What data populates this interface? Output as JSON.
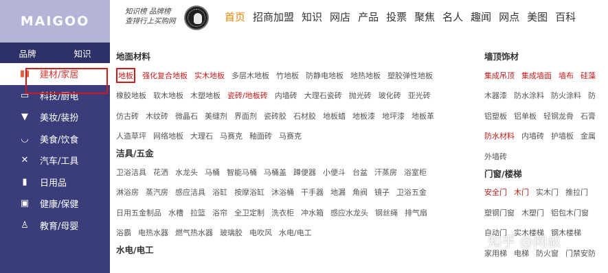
{
  "header": {
    "logo": "MAIGOO",
    "slogan_line1": "知识榜 品牌榜",
    "slogan_line2": "查排行上买购网",
    "nav": [
      "首页",
      "招商加盟",
      "知识",
      "网店",
      "产品",
      "投票",
      "聚焦",
      "名人",
      "趣闻",
      "网点",
      "美图",
      "百科"
    ]
  },
  "sidebar": {
    "tabs": [
      "品牌",
      "知识"
    ],
    "items": [
      {
        "icon": "building-icon",
        "label": "建材/家居"
      },
      {
        "icon": "monitor-icon",
        "label": "科技/厨电"
      },
      {
        "icon": "shirt-icon",
        "label": "美妆/装扮"
      },
      {
        "icon": "bowl-icon",
        "label": "美食/饮食"
      },
      {
        "icon": "tools-icon",
        "label": "汽车/工具"
      },
      {
        "icon": "bottle-icon",
        "label": "日用品"
      },
      {
        "icon": "medkit-icon",
        "label": "健康/保健"
      },
      {
        "icon": "child-icon",
        "label": "教育/母婴"
      }
    ]
  },
  "content": {
    "col1": [
      {
        "title": "地面材料",
        "rows": [
          [
            {
              "t": "地板",
              "boxed": true
            },
            {
              "t": "强化复合地板",
              "red": true
            },
            {
              "t": "实木地板",
              "red": true
            },
            {
              "t": "多层木地板"
            },
            {
              "t": "竹地板"
            },
            {
              "t": "防静电地板"
            },
            {
              "t": "地热地板"
            },
            {
              "t": "塑胶弹性地板"
            }
          ],
          [
            {
              "t": "橡胶地板"
            },
            {
              "t": "软木地板"
            },
            {
              "t": "木塑地板"
            },
            {
              "t": "瓷砖/地板砖",
              "red": true
            },
            {
              "t": "内墙砖"
            },
            {
              "t": "大理石瓷砖"
            },
            {
              "t": "抛光砖"
            },
            {
              "t": "玻化砖"
            },
            {
              "t": "亚光砖"
            }
          ],
          [
            {
              "t": "仿古砖"
            },
            {
              "t": "木纹砖"
            },
            {
              "t": "微晶石"
            },
            {
              "t": "美缝剂"
            },
            {
              "t": "界面剂"
            },
            {
              "t": "瓷砖胶"
            },
            {
              "t": "石材胶"
            },
            {
              "t": "地板蜡"
            },
            {
              "t": "地板漆"
            },
            {
              "t": "地坪漆"
            },
            {
              "t": "地板革"
            }
          ],
          [
            {
              "t": "人造草坪"
            },
            {
              "t": "网络地板"
            },
            {
              "t": "大理石"
            },
            {
              "t": "马赛克"
            },
            {
              "t": "釉面砖"
            },
            {
              "t": "马赛克"
            }
          ]
        ]
      },
      {
        "title": "洁具/五金",
        "rows": [
          [
            {
              "t": "卫浴洁具"
            },
            {
              "t": "花洒"
            },
            {
              "t": "水龙头"
            },
            {
              "t": "马桶"
            },
            {
              "t": "智能马桶"
            },
            {
              "t": "马桶盖"
            },
            {
              "t": "蹲便器"
            },
            {
              "t": "小便斗"
            },
            {
              "t": "台盆"
            },
            {
              "t": "汗蒸房"
            },
            {
              "t": "浴室柜"
            }
          ],
          [
            {
              "t": "淋浴房"
            },
            {
              "t": "蒸汽房"
            },
            {
              "t": "感应洁具"
            },
            {
              "t": "浴缸"
            },
            {
              "t": "按摩浴缸"
            },
            {
              "t": "沐浴桶"
            },
            {
              "t": "干手器"
            },
            {
              "t": "地漏"
            },
            {
              "t": "角阀"
            },
            {
              "t": "镜子"
            },
            {
              "t": "卫浴五金"
            }
          ],
          [
            {
              "t": "日用五金制品"
            },
            {
              "t": "水槽"
            },
            {
              "t": "拉篮"
            },
            {
              "t": "浴帘"
            },
            {
              "t": "全卫定制"
            },
            {
              "t": "洗衣柜"
            },
            {
              "t": "冲水箱"
            },
            {
              "t": "感应水龙头"
            },
            {
              "t": "钢丝绳"
            },
            {
              "t": "排气扇"
            }
          ],
          [
            {
              "t": "浴霸"
            },
            {
              "t": "电热水器"
            },
            {
              "t": "燃气热水器"
            },
            {
              "t": "玻璃胶"
            },
            {
              "t": "电吹风"
            },
            {
              "t": "水电/电工"
            }
          ]
        ]
      },
      {
        "title": "水电/电工",
        "rows": []
      }
    ],
    "col2": [
      {
        "title": "墙顶饰材",
        "rows": [
          [
            {
              "t": "集成吊顶",
              "red": true
            },
            {
              "t": "集成墙面",
              "red": true
            },
            {
              "t": "墙布",
              "red": true
            },
            {
              "t": "硅藻",
              "red": true
            }
          ],
          [
            {
              "t": "木器漆"
            },
            {
              "t": "防水涂料"
            },
            {
              "t": "防火涂料"
            },
            {
              "t": "防"
            }
          ],
          [
            {
              "t": "铝塑板"
            },
            {
              "t": "铝单板"
            },
            {
              "t": "轻钢龙骨"
            },
            {
              "t": "石膏"
            }
          ],
          [
            {
              "t": "防水材料",
              "red": true
            },
            {
              "t": "内墙砖"
            },
            {
              "t": "护墙板"
            },
            {
              "t": "金属"
            }
          ],
          [
            {
              "t": "外墙砖"
            }
          ]
        ]
      },
      {
        "title": "门窗/楼梯",
        "rows": [
          [
            {
              "t": "安全门",
              "red": true
            },
            {
              "t": "木门",
              "red": true
            },
            {
              "t": "实木门"
            },
            {
              "t": "推拉门"
            }
          ],
          [
            {
              "t": "塑钢门窗"
            },
            {
              "t": "木塑门"
            },
            {
              "t": "铝包木门窗"
            }
          ],
          [
            {
              "t": "自动门"
            },
            {
              "t": "实木楼梯"
            },
            {
              "t": "钢木楼梯"
            }
          ],
          [
            {
              "t": "家用梯"
            },
            {
              "t": "电梯"
            },
            {
              "t": "防火窗"
            },
            {
              "t": "门禁安防"
            }
          ]
        ]
      }
    ]
  },
  "watermark": "知乎 @网叔"
}
